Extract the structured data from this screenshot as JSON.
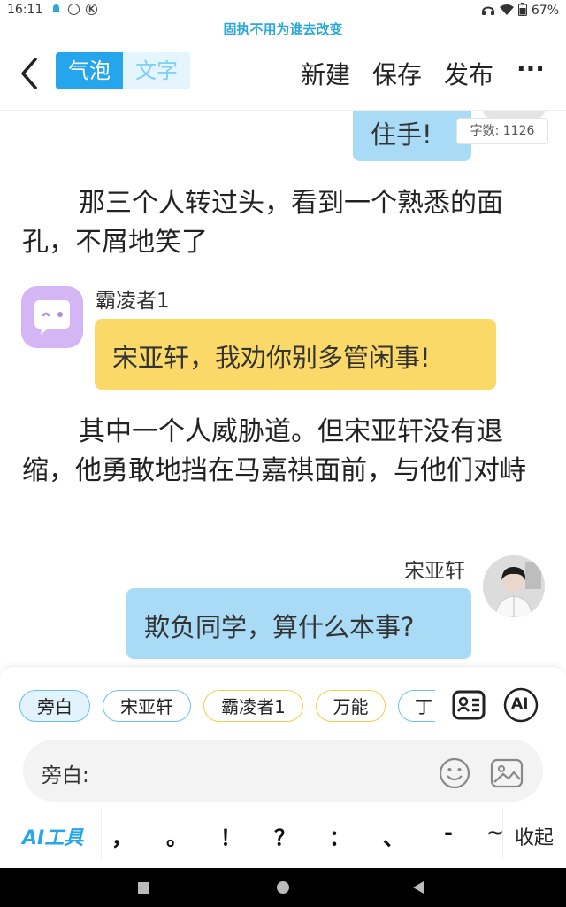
{
  "status": {
    "time": "16:11",
    "battery": "67%",
    "icons": [
      "notification-icon",
      "sync-icon",
      "k-icon",
      "headset-icon",
      "wifi-icon",
      "battery-icon"
    ]
  },
  "banner": "固执不用为谁去改变",
  "header": {
    "mode_tabs": [
      "气泡",
      "文字"
    ],
    "actions": [
      "新建",
      "保存",
      "发布"
    ],
    "more": "···"
  },
  "story": {
    "top_bubble": "住手!",
    "word_count": "字数: 1126",
    "narration_1": "那三个人转过头，看到一个熟悉的面孔，不屑地笑了",
    "msg_1": {
      "speaker": "霸凌者1",
      "text": "宋亚轩，我劝你别多管闲事!"
    },
    "narration_2": "其中一个人威胁道。但宋亚轩没有退缩，他勇敢地挡在马嘉祺面前，与他们对峙",
    "msg_2": {
      "speaker": "宋亚轩",
      "text": "欺负同学，算什么本事?"
    }
  },
  "composer": {
    "roles": [
      "旁白",
      "宋亚轩",
      "霸凌者1",
      "万能",
      "丁"
    ],
    "selected_role": "旁白",
    "input_label": "旁白:",
    "ai_tools": "AI工具",
    "ai_badge": "AI",
    "punctuation": [
      "，",
      "。",
      "！",
      "？",
      "：",
      "、",
      "-",
      "~"
    ],
    "collapse": "收起"
  },
  "colors": {
    "accent_blue": "#25a6ec",
    "bubble_blue": "#a9dbf7",
    "bubble_yellow": "#fbd969",
    "avatar_purple": "#d3b6f3",
    "banner_text": "#2aa8d8"
  }
}
